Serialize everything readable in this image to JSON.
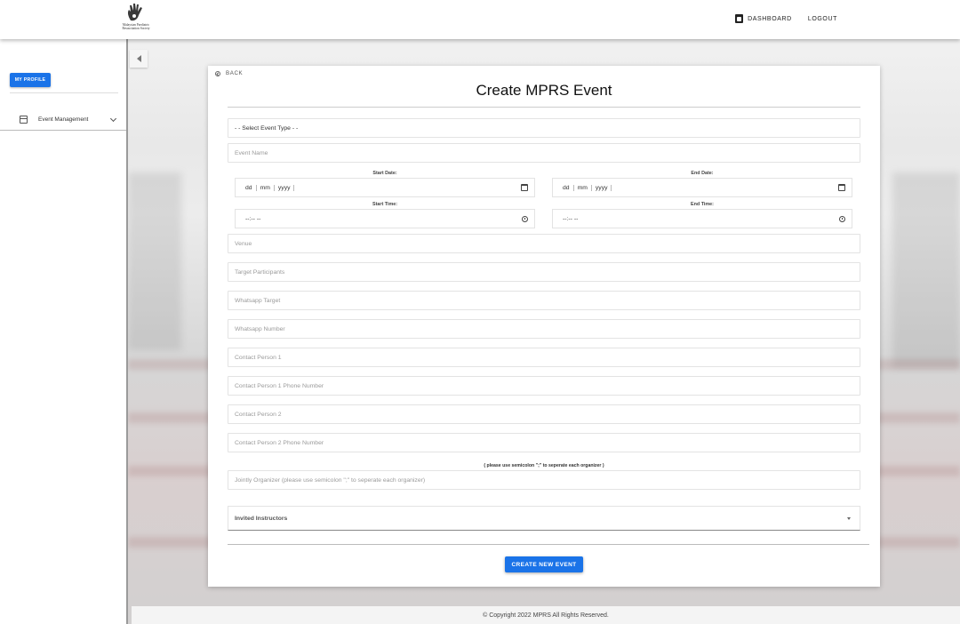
{
  "header": {
    "logo_text": "Malaysian Paediatric Resuscitation Society",
    "nav": {
      "dashboard": "DASHBOARD",
      "logout": "LOGOUT"
    }
  },
  "sidebar": {
    "profile_button": "MY PROFILE",
    "items": [
      {
        "label": "Event Management",
        "icon": "calendar-icon"
      }
    ]
  },
  "form": {
    "back": "BACK",
    "title": "Create MPRS Event",
    "event_type": "- - Select Event Type - -",
    "event_name_placeholder": "Event Name",
    "start_date_label": "Start Date:",
    "end_date_label": "End Date:",
    "date_segments": {
      "dd": "dd",
      "mm": "mm",
      "yyyy": "yyyy"
    },
    "start_time_label": "Start Time:",
    "end_time_label": "End Time:",
    "time_placeholder": "--:-- --",
    "venue_placeholder": "Venue",
    "target_participants_placeholder": "Target Participants",
    "whatsapp_target_placeholder": "Whatsapp Target",
    "whatsapp_number_placeholder": "Whatsapp Number",
    "contact1_placeholder": "Contact Person 1",
    "contact1_phone_placeholder": "Contact Person 1 Phone Number",
    "contact2_placeholder": "Contact Person 2",
    "contact2_phone_placeholder": "Contact Person 2 Phone Number",
    "organizer_note": "( please use semicolon \";\" to seperate each organizer )",
    "organizer_placeholder": "Jointly Organizer (please use semicolon \";\" to seperate each organizer)",
    "invited_instructors": "Invited Instructors",
    "submit": "CREATE NEW EVENT"
  },
  "footer": {
    "copyright": "© Copyright 2022 MPRS All Rights Reserved."
  },
  "colors": {
    "accent": "#1a73e8"
  }
}
